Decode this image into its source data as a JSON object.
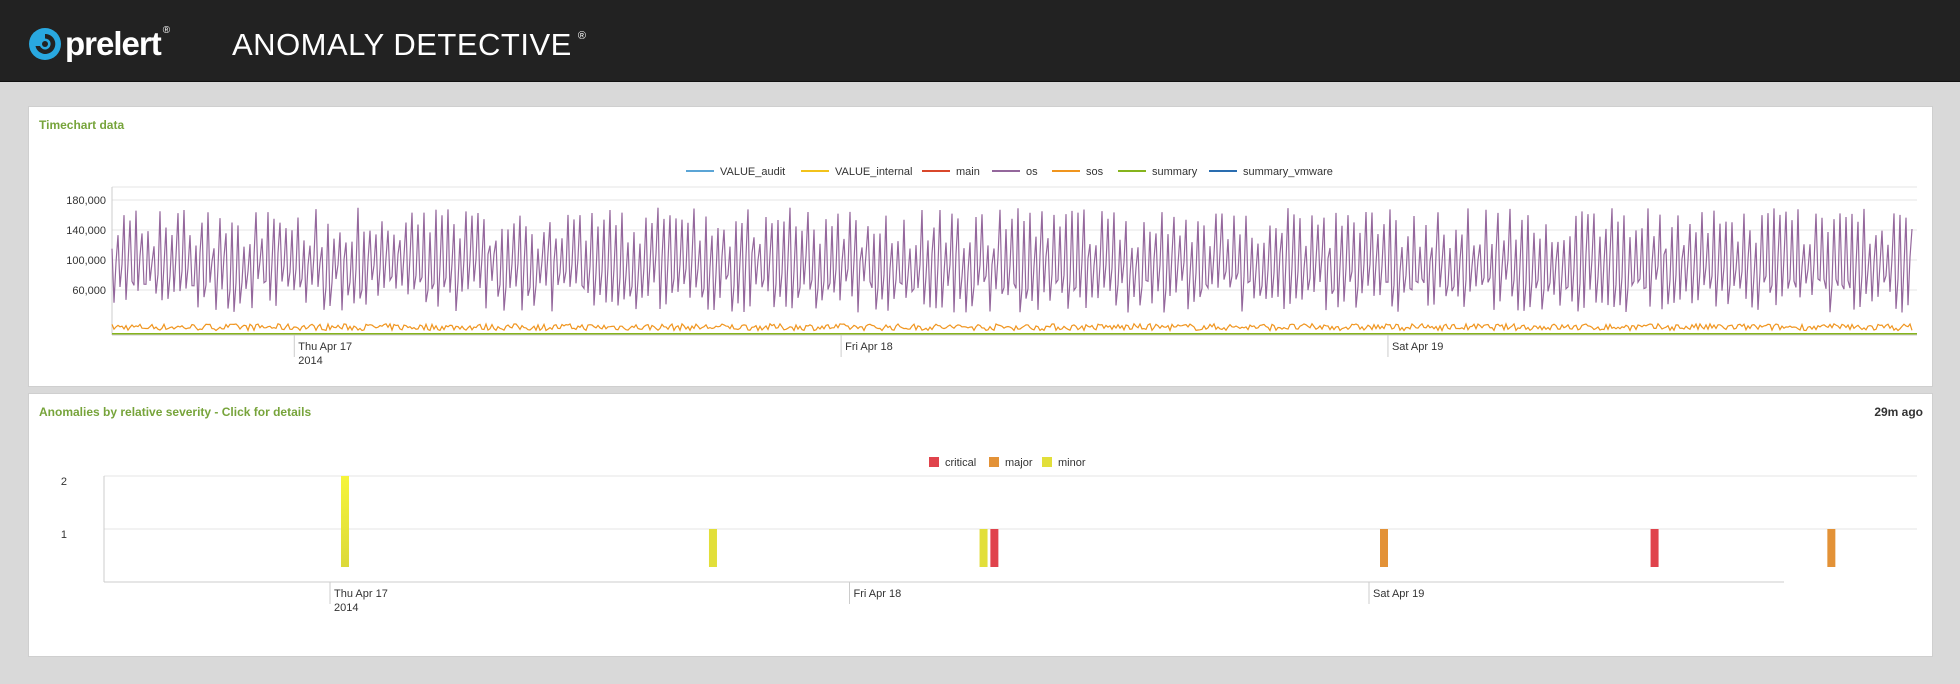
{
  "header": {
    "brand": "prelert",
    "brand_mark": "®",
    "product": "ANOMALY DETECTIVE",
    "product_mark": "®"
  },
  "timechart": {
    "title": "Timechart data",
    "legend": [
      {
        "name": "VALUE_audit",
        "color": "#5ba5d6"
      },
      {
        "name": "VALUE_internal",
        "color": "#f2c21b"
      },
      {
        "name": "main",
        "color": "#d9472b"
      },
      {
        "name": "os",
        "color": "#94679c"
      },
      {
        "name": "sos",
        "color": "#f0951e"
      },
      {
        "name": "summary",
        "color": "#86b41d"
      },
      {
        "name": "summary_vmware",
        "color": "#2a6db0"
      }
    ],
    "y_ticks": [
      "180,000",
      "140,000",
      "100,000",
      "60,000"
    ],
    "x_ticks": [
      {
        "day": "Thu Apr 17",
        "year": "2014"
      },
      {
        "day": "Fri Apr 18",
        "year": ""
      },
      {
        "day": "Sat Apr 19",
        "year": ""
      }
    ]
  },
  "anomalies": {
    "title": "Anomalies by relative severity - Click for details",
    "updated": "29m ago",
    "legend": [
      {
        "name": "critical",
        "color": "#e0434c"
      },
      {
        "name": "major",
        "color": "#e39237"
      },
      {
        "name": "minor",
        "color": "#e2df3a"
      }
    ],
    "y_ticks": [
      "2",
      "1"
    ],
    "x_ticks": [
      {
        "day": "Thu Apr 17",
        "year": "2014"
      },
      {
        "day": "Fri Apr 18",
        "year": ""
      },
      {
        "day": "Sat Apr 19",
        "year": ""
      }
    ]
  },
  "chart_data": [
    {
      "type": "line",
      "title": "Timechart data",
      "x_range": [
        "2014-04-16 16:00",
        "2014-04-19 23:00"
      ],
      "x_ticks": [
        "Thu Apr 17 2014",
        "Fri Apr 18",
        "Sat Apr 19"
      ],
      "ylim": [
        0,
        190000
      ],
      "y_ticks": [
        60000,
        100000,
        140000,
        180000
      ],
      "grid": true,
      "legend_position": "top",
      "series": [
        {
          "name": "VALUE_audit",
          "approx_range": [
            0,
            0
          ]
        },
        {
          "name": "VALUE_internal",
          "approx_range": [
            0,
            0
          ]
        },
        {
          "name": "main",
          "approx_range": [
            0,
            0
          ]
        },
        {
          "name": "os",
          "approx_range": [
            20000,
            175000
          ],
          "typical_peak": 140000,
          "typical_trough": 30000
        },
        {
          "name": "sos",
          "approx_range": [
            5000,
            15000
          ]
        },
        {
          "name": "summary",
          "approx_range": [
            0,
            0
          ]
        },
        {
          "name": "summary_vmware",
          "approx_range": [
            0,
            0
          ]
        }
      ]
    },
    {
      "type": "bar",
      "title": "Anomalies by relative severity - Click for details",
      "ylim": [
        0,
        2
      ],
      "y_ticks": [
        1,
        2
      ],
      "x_ticks": [
        "Thu Apr 17 2014",
        "Fri Apr 18",
        "Sat Apr 19"
      ],
      "legend_position": "top",
      "series": [
        {
          "name": "critical",
          "points": [
            {
              "time": "2014-04-18 06:00",
              "value": 1
            },
            {
              "time": "2014-04-19 12:30",
              "value": 1
            }
          ]
        },
        {
          "name": "major",
          "points": [
            {
              "time": "2014-04-19 00:00",
              "value": 1
            },
            {
              "time": "2014-04-19 20:40",
              "value": 1
            }
          ]
        },
        {
          "name": "minor",
          "points": [
            {
              "time": "2014-04-17 00:00",
              "value": 2
            },
            {
              "time": "2014-04-17 17:00",
              "value": 1
            },
            {
              "time": "2014-04-18 05:30",
              "value": 1
            }
          ]
        }
      ],
      "timeline_start": "2014-04-16 17:00",
      "timeline_end": "2014-04-19 23:00"
    }
  ]
}
